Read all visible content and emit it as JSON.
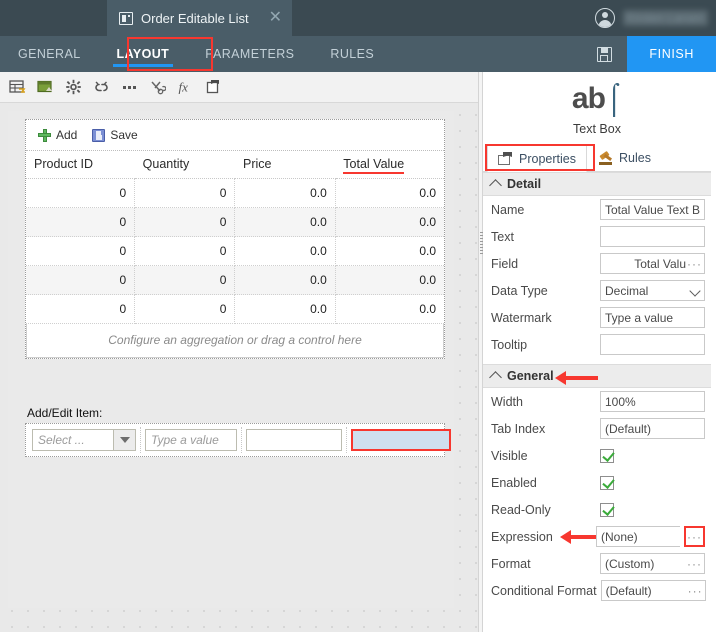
{
  "topbar": {
    "document_tab": {
      "title": "Order Editable List",
      "icon": "list-form-icon",
      "close_icon": "close-icon"
    },
    "user": {
      "name": "Kirsten Larsen",
      "avatar_icon": "user-avatar-icon"
    }
  },
  "navbar": {
    "tabs": [
      {
        "label": "GENERAL",
        "active": false
      },
      {
        "label": "LAYOUT",
        "active": true
      },
      {
        "label": "PARAMETERS",
        "active": false
      },
      {
        "label": "RULES",
        "active": false
      }
    ],
    "save_icon": "floppy-disk-icon",
    "finish_label": "FINISH",
    "accent_color": "#2196f3",
    "bar_color": "#4a5d68",
    "annotation_color": "#f7372f"
  },
  "designer": {
    "toolbar_icons": [
      "insert-grid-icon",
      "insert-image-icon",
      "settings-gear-icon",
      "break-link-icon",
      "more-options-icon",
      "cut-icon",
      "formula-icon",
      "paste-icon"
    ],
    "widget": {
      "toolbar": [
        {
          "label": "Add",
          "icon": "add-plus-icon"
        },
        {
          "label": "Save",
          "icon": "save-floppy-icon"
        }
      ],
      "columns": [
        "Product ID",
        "Quantity",
        "Price",
        "Total Value"
      ],
      "selected_column": "Total Value",
      "rows": [
        [
          "0",
          "0",
          "0.0",
          "0.0"
        ],
        [
          "0",
          "0",
          "0.0",
          "0.0"
        ],
        [
          "0",
          "0",
          "0.0",
          "0.0"
        ],
        [
          "0",
          "0",
          "0.0",
          "0.0"
        ],
        [
          "0",
          "0",
          "0.0",
          "0.0"
        ]
      ],
      "aggregation_placeholder": "Configure an aggregation or drag a control here"
    },
    "add_edit": {
      "label": "Add/Edit Item:",
      "select_placeholder": "Select ...",
      "text_placeholder": "Type a value",
      "third_value": "",
      "fourth_value": ""
    }
  },
  "properties": {
    "control_icon": "text-box-ab-icon",
    "control_icon_text": "ab",
    "control_type": "Text Box",
    "tabs": [
      {
        "label": "Properties",
        "icon": "properties-tag-icon",
        "active": true
      },
      {
        "label": "Rules",
        "icon": "rules-gavel-icon",
        "active": false
      }
    ],
    "sections": [
      {
        "title": "Detail",
        "rows": [
          {
            "label": "Name",
            "value": "Total Value Text B",
            "type": "text"
          },
          {
            "label": "Text",
            "value": "",
            "type": "text"
          },
          {
            "label": "Field",
            "value": "Total Valu",
            "type": "picker"
          },
          {
            "label": "Data Type",
            "value": "Decimal",
            "type": "select"
          },
          {
            "label": "Watermark",
            "value": "Type a value",
            "type": "text"
          },
          {
            "label": "Tooltip",
            "value": "",
            "type": "text"
          }
        ]
      },
      {
        "title": "General",
        "rows": [
          {
            "label": "Width",
            "value": "100%",
            "type": "text"
          },
          {
            "label": "Tab Index",
            "value": "(Default)",
            "type": "text"
          },
          {
            "label": "Visible",
            "value": "checked",
            "type": "checkbox"
          },
          {
            "label": "Enabled",
            "value": "checked",
            "type": "checkbox"
          },
          {
            "label": "Read-Only",
            "value": "checked",
            "type": "checkbox"
          },
          {
            "label": "Expression",
            "value": "(None)",
            "type": "picker-highlighted"
          },
          {
            "label": "Format",
            "value": "(Custom)",
            "type": "picker"
          },
          {
            "label": "Conditional Format",
            "value": "(Default)",
            "type": "picker"
          }
        ]
      }
    ],
    "ellipsis_glyph": "···"
  }
}
